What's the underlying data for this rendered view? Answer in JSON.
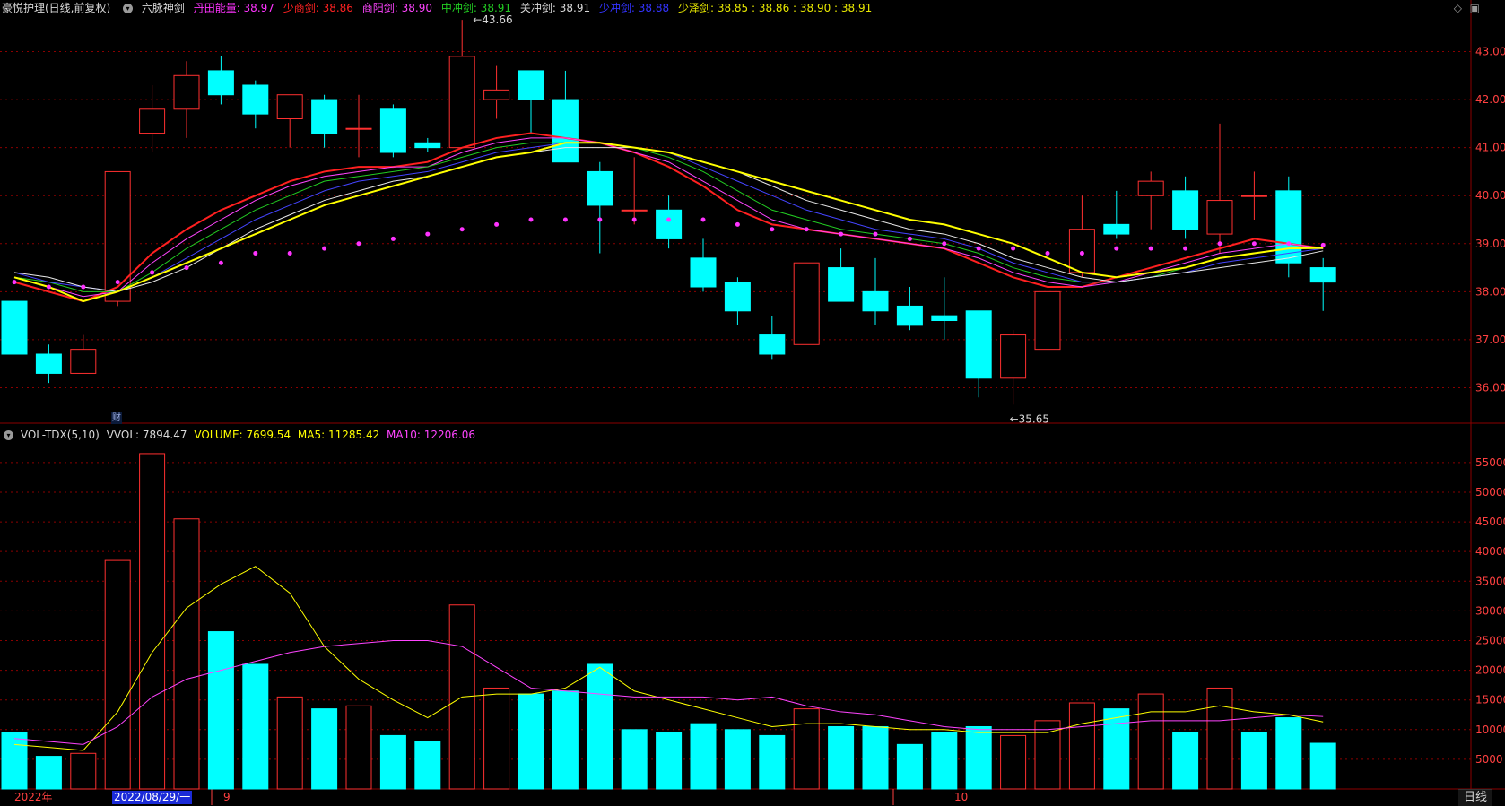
{
  "header": {
    "stock_title": "豪悦护理(日线,前复权)",
    "indicator_name": "六脉神剑",
    "items": [
      {
        "label": "丹田能量: 38.97",
        "color": "#ff33ff"
      },
      {
        "label": "少商剑: 38.86",
        "color": "#ff2222"
      },
      {
        "label": "商阳剑: 38.90",
        "color": "#ff44ff"
      },
      {
        "label": "中冲剑: 38.91",
        "color": "#22cc22"
      },
      {
        "label": "关冲剑: 38.91",
        "color": "#d8d8d8"
      },
      {
        "label": "少冲剑: 38.88",
        "color": "#3333ff"
      },
      {
        "label": "少泽剑: 38.85 : 38.86 : 38.90 : 38.91",
        "color": "#e8e800"
      }
    ],
    "buttons": [
      "◇",
      "▣"
    ]
  },
  "volume_header": {
    "name": "VOL-TDX(5,10)",
    "items": [
      {
        "label": "VVOL: 7894.47",
        "color": "#d8d8d8"
      },
      {
        "label": "VOLUME: 7699.54",
        "color": "#ffff00"
      },
      {
        "label": "MA5: 11285.42",
        "color": "#ffff00"
      },
      {
        "label": "MA10: 12206.06",
        "color": "#ff44ff"
      }
    ]
  },
  "annotations": {
    "high_label": "43.66",
    "low_label": "35.65",
    "fin_marker": "财"
  },
  "footer": {
    "year_label": "2022年",
    "cursor_date": "2022/08/29/一",
    "month_sep": "9",
    "month_oct": "10",
    "period_tab": "日线"
  },
  "colors": {
    "up": "#ff3030",
    "down": "#00ffff",
    "grid": "#8b0000",
    "axis_text": "#ff4040",
    "ma5": "#ffff00",
    "ma10": "#ff44ff",
    "dot": "#ff33ff"
  },
  "chart_data": [
    {
      "type": "candlestick",
      "title": "豪悦护理(日线,前复权)",
      "ylim": [
        35.3,
        43.7
      ],
      "yticks": [
        36,
        37,
        38,
        39,
        40,
        41,
        42,
        43
      ],
      "candles": [
        {
          "o": 37.8,
          "h": 37.8,
          "l": 36.7,
          "c": 36.7
        },
        {
          "o": 36.7,
          "h": 36.9,
          "l": 36.1,
          "c": 36.3
        },
        {
          "o": 36.3,
          "h": 37.1,
          "l": 36.3,
          "c": 36.8
        },
        {
          "o": 37.8,
          "h": 40.5,
          "l": 37.7,
          "c": 40.5
        },
        {
          "o": 41.3,
          "h": 42.3,
          "l": 40.9,
          "c": 41.8
        },
        {
          "o": 41.8,
          "h": 42.8,
          "l": 41.2,
          "c": 42.5
        },
        {
          "o": 42.6,
          "h": 42.9,
          "l": 41.9,
          "c": 42.1
        },
        {
          "o": 42.3,
          "h": 42.4,
          "l": 41.4,
          "c": 41.7
        },
        {
          "o": 41.6,
          "h": 42.1,
          "l": 41.0,
          "c": 42.1
        },
        {
          "o": 42.0,
          "h": 42.1,
          "l": 41.0,
          "c": 41.3
        },
        {
          "o": 41.4,
          "h": 42.1,
          "l": 40.8,
          "c": 41.4
        },
        {
          "o": 41.8,
          "h": 41.9,
          "l": 40.8,
          "c": 40.9
        },
        {
          "o": 41.1,
          "h": 41.2,
          "l": 40.9,
          "c": 41.0
        },
        {
          "o": 41.0,
          "h": 43.66,
          "l": 41.0,
          "c": 42.9
        },
        {
          "o": 42.0,
          "h": 42.7,
          "l": 41.6,
          "c": 42.2
        },
        {
          "o": 42.6,
          "h": 42.6,
          "l": 41.3,
          "c": 42.0
        },
        {
          "o": 42.0,
          "h": 42.6,
          "l": 40.7,
          "c": 40.7
        },
        {
          "o": 40.5,
          "h": 40.7,
          "l": 38.8,
          "c": 39.8
        },
        {
          "o": 39.7,
          "h": 40.8,
          "l": 39.4,
          "c": 39.7
        },
        {
          "o": 39.7,
          "h": 40.0,
          "l": 38.9,
          "c": 39.1
        },
        {
          "o": 38.7,
          "h": 39.1,
          "l": 38.0,
          "c": 38.1
        },
        {
          "o": 38.2,
          "h": 38.3,
          "l": 37.3,
          "c": 37.6
        },
        {
          "o": 37.1,
          "h": 37.5,
          "l": 36.6,
          "c": 36.7
        },
        {
          "o": 36.9,
          "h": 38.6,
          "l": 36.9,
          "c": 38.6
        },
        {
          "o": 38.5,
          "h": 38.9,
          "l": 37.8,
          "c": 37.8
        },
        {
          "o": 38.0,
          "h": 38.7,
          "l": 37.3,
          "c": 37.6
        },
        {
          "o": 37.7,
          "h": 38.1,
          "l": 37.2,
          "c": 37.3
        },
        {
          "o": 37.5,
          "h": 38.3,
          "l": 37.0,
          "c": 37.4
        },
        {
          "o": 37.6,
          "h": 37.6,
          "l": 35.8,
          "c": 36.2
        },
        {
          "o": 36.2,
          "h": 37.2,
          "l": 35.65,
          "c": 37.1
        },
        {
          "o": 36.8,
          "h": 38.0,
          "l": 36.8,
          "c": 38.0
        },
        {
          "o": 38.4,
          "h": 40.0,
          "l": 38.3,
          "c": 39.3
        },
        {
          "o": 39.4,
          "h": 40.1,
          "l": 39.1,
          "c": 39.2
        },
        {
          "o": 40.0,
          "h": 40.5,
          "l": 39.3,
          "c": 40.3
        },
        {
          "o": 40.1,
          "h": 40.4,
          "l": 39.1,
          "c": 39.3
        },
        {
          "o": 39.2,
          "h": 41.5,
          "l": 38.8,
          "c": 39.9
        },
        {
          "o": 40.0,
          "h": 40.5,
          "l": 39.5,
          "c": 40.0
        },
        {
          "o": 40.1,
          "h": 40.4,
          "l": 38.3,
          "c": 38.6
        },
        {
          "o": 38.5,
          "h": 38.7,
          "l": 37.6,
          "c": 38.2
        }
      ],
      "series": [
        {
          "values": [
            38.2,
            38.0,
            37.8,
            38.1,
            38.8,
            39.3,
            39.7,
            40.0,
            40.3,
            40.5,
            40.6,
            40.6,
            40.7,
            41.0,
            41.2,
            41.3,
            41.2,
            41.1,
            40.9,
            40.6,
            40.2,
            39.7,
            39.4,
            39.3,
            39.2,
            39.1,
            39.0,
            38.9,
            38.6,
            38.3,
            38.1,
            38.1,
            38.3,
            38.5,
            38.7,
            38.9,
            39.1,
            39.0,
            38.9
          ],
          "color": "#ff2020"
        },
        {
          "values": [
            38.3,
            38.1,
            37.9,
            38.0,
            38.6,
            39.1,
            39.5,
            39.9,
            40.2,
            40.4,
            40.5,
            40.6,
            40.6,
            40.9,
            41.1,
            41.2,
            41.2,
            41.1,
            40.9,
            40.7,
            40.3,
            39.9,
            39.5,
            39.3,
            39.2,
            39.1,
            39.0,
            38.9,
            38.7,
            38.4,
            38.2,
            38.1,
            38.2,
            38.4,
            38.6,
            38.8,
            38.9,
            39.0,
            38.9
          ],
          "color": "#ff44ff"
        },
        {
          "values": [
            38.3,
            38.2,
            38.0,
            38.0,
            38.4,
            38.9,
            39.3,
            39.7,
            40.0,
            40.3,
            40.4,
            40.5,
            40.6,
            40.8,
            41.0,
            41.1,
            41.1,
            41.1,
            41.0,
            40.8,
            40.5,
            40.1,
            39.7,
            39.5,
            39.3,
            39.2,
            39.1,
            39.0,
            38.8,
            38.5,
            38.3,
            38.2,
            38.2,
            38.3,
            38.5,
            38.7,
            38.8,
            38.9,
            38.9
          ],
          "color": "#22cc22"
        },
        {
          "values": [
            38.4,
            38.2,
            38.1,
            38.0,
            38.3,
            38.7,
            39.1,
            39.5,
            39.8,
            40.1,
            40.3,
            40.4,
            40.5,
            40.7,
            40.9,
            41.0,
            41.1,
            41.1,
            41.0,
            40.9,
            40.6,
            40.3,
            40.0,
            39.7,
            39.5,
            39.3,
            39.2,
            39.1,
            38.9,
            38.6,
            38.4,
            38.2,
            38.2,
            38.3,
            38.4,
            38.6,
            38.7,
            38.8,
            38.9
          ],
          "color": "#4444ff"
        },
        {
          "values": [
            38.4,
            38.3,
            38.1,
            38.0,
            38.2,
            38.5,
            38.9,
            39.3,
            39.6,
            39.9,
            40.1,
            40.3,
            40.4,
            40.6,
            40.8,
            40.9,
            41.0,
            41.0,
            41.0,
            40.9,
            40.7,
            40.5,
            40.2,
            39.9,
            39.7,
            39.5,
            39.3,
            39.2,
            39.0,
            38.7,
            38.5,
            38.3,
            38.2,
            38.3,
            38.4,
            38.5,
            38.6,
            38.7,
            38.85
          ],
          "color": "#e8e8e8"
        },
        {
          "values": [
            38.3,
            38.1,
            37.8,
            38.0,
            38.3,
            38.6,
            38.9,
            39.2,
            39.5,
            39.8,
            40.0,
            40.2,
            40.4,
            40.6,
            40.8,
            40.9,
            41.1,
            41.1,
            41.0,
            40.9,
            40.7,
            40.5,
            40.3,
            40.1,
            39.9,
            39.7,
            39.5,
            39.4,
            39.2,
            39.0,
            38.7,
            38.4,
            38.3,
            38.4,
            38.5,
            38.7,
            38.8,
            38.9,
            38.91
          ],
          "color": "#ffff00"
        }
      ],
      "dots": [
        38.2,
        38.1,
        38.1,
        38.2,
        38.4,
        38.5,
        38.6,
        38.8,
        38.8,
        38.9,
        39.0,
        39.1,
        39.2,
        39.3,
        39.4,
        39.5,
        39.5,
        39.5,
        39.5,
        39.5,
        39.5,
        39.4,
        39.3,
        39.3,
        39.2,
        39.2,
        39.1,
        39.0,
        38.9,
        38.9,
        38.8,
        38.8,
        38.9,
        38.9,
        38.9,
        39.0,
        39.0,
        39.0,
        38.97
      ]
    },
    {
      "type": "bar",
      "title": "VOL-TDX(5,10)",
      "ylim": [
        0,
        58000
      ],
      "yticks": [
        5000,
        10000,
        15000,
        20000,
        25000,
        30000,
        35000,
        40000,
        45000,
        50000,
        55000
      ],
      "values": [
        9500,
        5500,
        6000,
        38500,
        56500,
        45500,
        26500,
        21000,
        15500,
        13500,
        14000,
        9000,
        8000,
        31000,
        17000,
        16000,
        16500,
        21000,
        10000,
        9500,
        11000,
        10000,
        9000,
        13500,
        10500,
        10500,
        7500,
        9500,
        10500,
        9000,
        11500,
        14500,
        13500,
        16000,
        9500,
        17000,
        9500,
        12000,
        7700
      ],
      "up": [
        false,
        false,
        true,
        true,
        true,
        true,
        false,
        false,
        true,
        false,
        true,
        false,
        false,
        true,
        true,
        false,
        false,
        false,
        false,
        false,
        false,
        false,
        false,
        true,
        false,
        false,
        false,
        false,
        false,
        true,
        true,
        true,
        false,
        true,
        false,
        true,
        false,
        false,
        false
      ],
      "ma5": [
        7500,
        7000,
        6500,
        13000,
        23000,
        30500,
        34500,
        37500,
        33000,
        24000,
        18500,
        15000,
        12000,
        15500,
        16000,
        16000,
        17000,
        20500,
        16500,
        15000,
        13500,
        12000,
        10500,
        11000,
        11000,
        10500,
        10000,
        10000,
        9500,
        9500,
        9500,
        11000,
        12000,
        13000,
        13000,
        14000,
        13000,
        12500,
        11285
      ],
      "ma10": [
        8500,
        8000,
        7500,
        10500,
        15500,
        18500,
        20000,
        21500,
        23000,
        24000,
        24500,
        25000,
        25000,
        24000,
        20500,
        17000,
        16500,
        16000,
        15500,
        15500,
        15500,
        15000,
        15500,
        14000,
        13000,
        12500,
        11500,
        10500,
        10000,
        10000,
        10000,
        10500,
        11000,
        11500,
        11500,
        11500,
        12000,
        12500,
        12206
      ],
      "color_ma5": "#ffff00",
      "color_ma10": "#ff44ff"
    }
  ]
}
